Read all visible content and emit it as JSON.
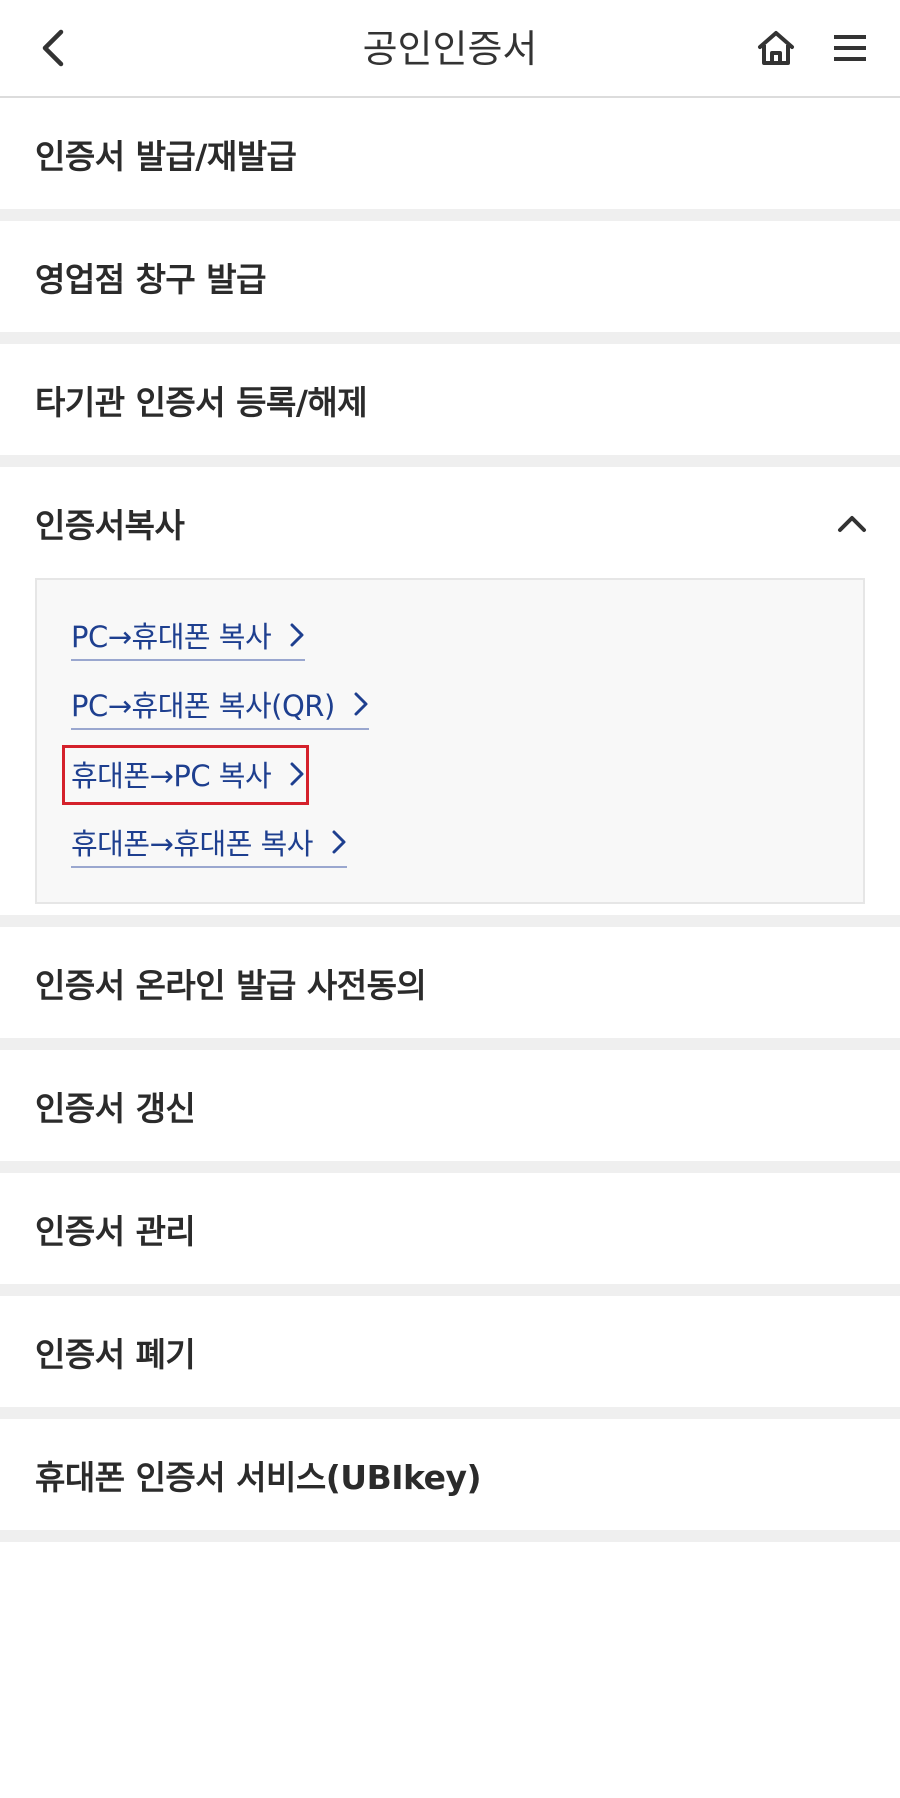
{
  "header": {
    "title": "공인인증서",
    "back_icon": "chevron-left-icon",
    "home_icon": "home-icon",
    "menu_icon": "hamburger-menu-icon"
  },
  "menu": {
    "items_before": [
      {
        "label": "인증서 발급/재발급"
      },
      {
        "label": "영업점 창구 발급"
      },
      {
        "label": "타기관 인증서 등록/해제"
      }
    ],
    "expanded": {
      "label": "인증서복사",
      "icon": "chevron-up-icon",
      "sub_items": [
        {
          "label": "PC→휴대폰 복사"
        },
        {
          "label": "PC→휴대폰 복사(QR)"
        },
        {
          "label": "휴대폰→PC 복사"
        },
        {
          "label": "휴대폰→휴대폰 복사"
        }
      ]
    },
    "items_after": [
      {
        "label": "인증서 온라인 발급 사전동의"
      },
      {
        "label": "인증서 갱신"
      },
      {
        "label": "인증서 관리"
      },
      {
        "label": "인증서 폐기"
      },
      {
        "label": "휴대폰 인증서 서비스(UBIkey)"
      }
    ]
  },
  "colors": {
    "link_text": "#1e3f8f",
    "highlight": "#d4212b",
    "separator": "#efefef"
  }
}
